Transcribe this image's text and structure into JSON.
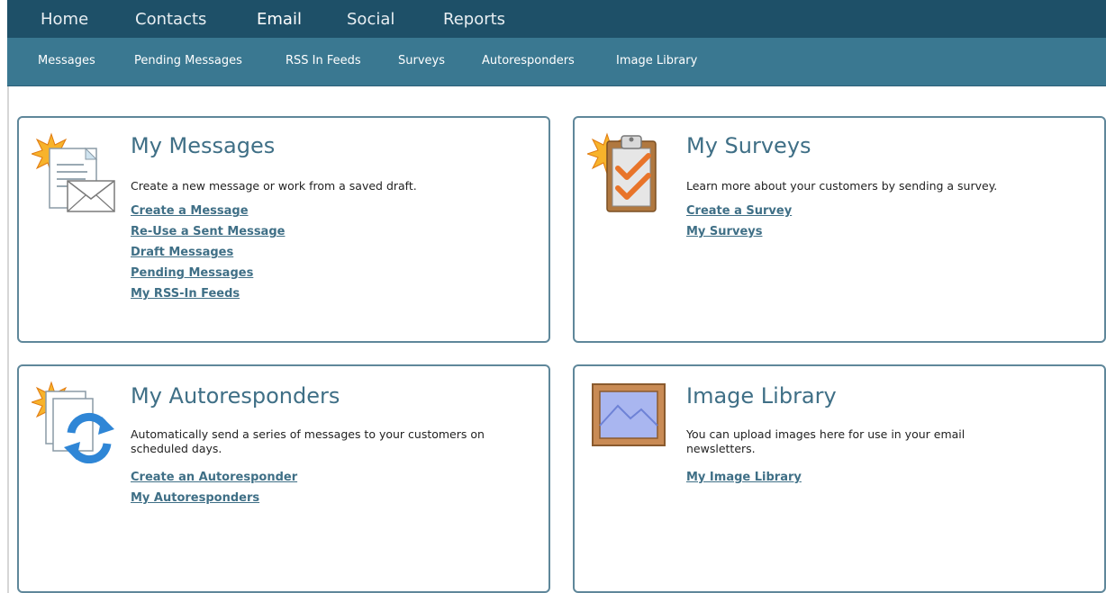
{
  "top_nav": {
    "tabs": [
      {
        "label": "Home"
      },
      {
        "label": "Contacts"
      },
      {
        "label": "Email"
      },
      {
        "label": "Social"
      },
      {
        "label": "Reports"
      }
    ],
    "active": "Email"
  },
  "sub_nav": {
    "items": [
      {
        "label": "Messages"
      },
      {
        "label": "Pending Messages"
      },
      {
        "label": "RSS In Feeds"
      },
      {
        "label": "Surveys"
      },
      {
        "label": "Autoresponders"
      },
      {
        "label": "Image Library"
      }
    ]
  },
  "panels": {
    "messages": {
      "title": "My Messages",
      "description": "Create a new message or work from a saved draft.",
      "icon": "messages-envelope-icon",
      "links": [
        "Create a Message",
        "Re-Use a Sent Message",
        "Draft Messages",
        "Pending Messages",
        "My RSS-In Feeds"
      ]
    },
    "surveys": {
      "title": "My Surveys",
      "description": "Learn more about your customers by sending a survey.",
      "icon": "survey-clipboard-icon",
      "links": [
        "Create a Survey",
        "My Surveys"
      ]
    },
    "autoresponders": {
      "title": "My Autoresponders",
      "description": "Automatically send a series of messages to your customers on scheduled days.",
      "icon": "autoresponder-cycle-icon",
      "links": [
        "Create an Autoresponder",
        "My Autoresponders"
      ]
    },
    "image_library": {
      "title": "Image Library",
      "description": "You can upload images here for use in your email newsletters.",
      "icon": "image-frame-icon",
      "links": [
        "My Image Library"
      ]
    }
  },
  "colors": {
    "top_nav_bg": "#1e5068",
    "sub_nav_bg": "#3a7891",
    "panel_border": "#5f879a",
    "title_color": "#3f6f86",
    "link_color": "#3f6f86"
  }
}
